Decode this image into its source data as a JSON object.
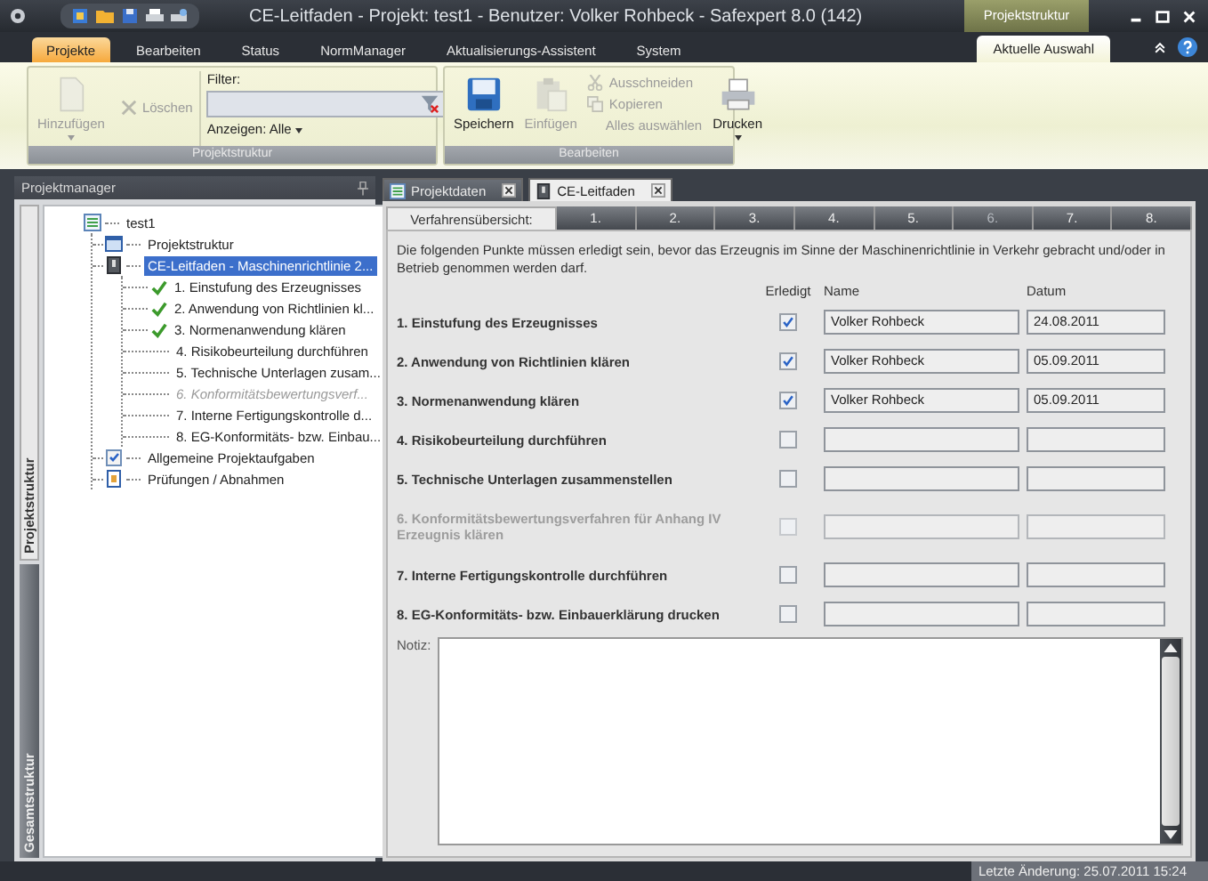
{
  "window": {
    "title": "CE-Leitfaden - Projekt: test1 - Benutzer: Volker Rohbeck - Safexpert 8.0 (142)",
    "context_label": "Projektstruktur"
  },
  "ribbon": {
    "tabs": [
      {
        "label": "Projekte",
        "selected": true
      },
      {
        "label": "Bearbeiten",
        "selected": false
      },
      {
        "label": "Status",
        "selected": false
      },
      {
        "label": "NormManager",
        "selected": false
      },
      {
        "label": "Aktualisierungs-Assistent",
        "selected": false
      },
      {
        "label": "System",
        "selected": false
      }
    ],
    "context_tab": "Aktuelle Auswahl",
    "groups": [
      {
        "label": "Projektstruktur",
        "buttons": [
          {
            "label": "Hinzufügen",
            "disabled": true
          },
          {
            "label": "Löschen",
            "disabled": true
          }
        ],
        "filter": {
          "label": "Filter:",
          "view": "Anzeigen: Alle"
        }
      },
      {
        "label": "Bearbeiten",
        "buttons": [
          {
            "label": "Speichern",
            "disabled": false
          },
          {
            "label": "Einfügen",
            "disabled": true
          },
          {
            "label": "Ausschneiden",
            "disabled": true
          },
          {
            "label": "Kopieren",
            "disabled": true
          },
          {
            "label": "Alles auswählen",
            "disabled": true
          },
          {
            "label": "Drucken",
            "disabled": false
          }
        ]
      }
    ]
  },
  "project_manager": {
    "title": "Projektmanager",
    "side_tabs": [
      {
        "label": "Projektstruktur",
        "selected": true
      },
      {
        "label": "Gesamtstruktur",
        "selected": false
      }
    ],
    "tree": {
      "label": "test1",
      "selected": false,
      "children": [
        {
          "label": "Projektstruktur",
          "selected": false
        },
        {
          "label": "CE-Leitfaden - Maschinenrichtlinie 2...",
          "selected": true,
          "children": [
            {
              "label": "1. Einstufung des Erzeugnisses",
              "done": true,
              "disabled": false,
              "selected": false
            },
            {
              "label": "2. Anwendung von Richtlinien kl...",
              "done": true,
              "disabled": false,
              "selected": false
            },
            {
              "label": "3. Normenanwendung klären",
              "done": true,
              "disabled": false,
              "selected": false
            },
            {
              "label": "4. Risikobeurteilung durchführen",
              "done": false,
              "disabled": false,
              "selected": false
            },
            {
              "label": "5. Technische Unterlagen zusam...",
              "done": false,
              "disabled": false,
              "selected": false
            },
            {
              "label": "6. Konformitätsbewertungsverf...",
              "done": false,
              "disabled": true,
              "selected": false
            },
            {
              "label": "7. Interne Fertigungskontrolle d...",
              "done": false,
              "disabled": false,
              "selected": false
            },
            {
              "label": "8. EG-Konformitäts- bzw. Einbau...",
              "done": false,
              "disabled": false,
              "selected": false
            }
          ]
        },
        {
          "label": "Allgemeine Projektaufgaben",
          "selected": false
        },
        {
          "label": "Prüfungen / Abnahmen",
          "selected": false
        }
      ]
    }
  },
  "document_tabs": [
    {
      "label": "Projektdaten",
      "selected": false
    },
    {
      "label": "CE-Leitfaden",
      "selected": true
    }
  ],
  "step_tabs": [
    {
      "label": "Verfahrensübersicht:",
      "selected": true,
      "disabled": false
    },
    {
      "label": "1.",
      "selected": false,
      "disabled": false
    },
    {
      "label": "2.",
      "selected": false,
      "disabled": false
    },
    {
      "label": "3.",
      "selected": false,
      "disabled": false
    },
    {
      "label": "4.",
      "selected": false,
      "disabled": false
    },
    {
      "label": "5.",
      "selected": false,
      "disabled": false
    },
    {
      "label": "6.",
      "selected": false,
      "disabled": true
    },
    {
      "label": "7.",
      "selected": false,
      "disabled": false
    },
    {
      "label": "8.",
      "selected": false,
      "disabled": false
    }
  ],
  "intro": "Die folgenden Punkte müssen erledigt sein, bevor das Erzeugnis im Sinne der Maschinenrichtlinie in Verkehr gebracht und/oder in Betrieb genommen werden darf.",
  "columns": [
    "Erledigt",
    "Name",
    "Datum"
  ],
  "steps": [
    {
      "label": "1. Einstufung des Erzeugnisses",
      "done": true,
      "disabled": false,
      "name": "Volker Rohbeck",
      "date": "24.08.2011"
    },
    {
      "label": "2. Anwendung von Richtlinien klären",
      "done": true,
      "disabled": false,
      "name": "Volker Rohbeck",
      "date": "05.09.2011"
    },
    {
      "label": "3. Normenanwendung klären",
      "done": true,
      "disabled": false,
      "name": "Volker Rohbeck",
      "date": "05.09.2011"
    },
    {
      "label": "4. Risikobeurteilung durchführen",
      "done": false,
      "disabled": false
    },
    {
      "label": "5. Technische Unterlagen zusammenstellen",
      "done": false,
      "disabled": false
    },
    {
      "label": "6. Konformitätsbewertungsverfahren für Anhang IV Erzeugnis klären",
      "done": false,
      "disabled": true
    },
    {
      "label": "7. Interne Fertigungskontrolle durchführen",
      "done": false,
      "disabled": false
    },
    {
      "label": "8. EG-Konformitäts- bzw. Einbauerklärung drucken",
      "done": false,
      "disabled": false
    }
  ],
  "notes": {
    "label": "Notiz:"
  },
  "status_bar": "Letzte Änderung: 25.07.2011 15:24"
}
